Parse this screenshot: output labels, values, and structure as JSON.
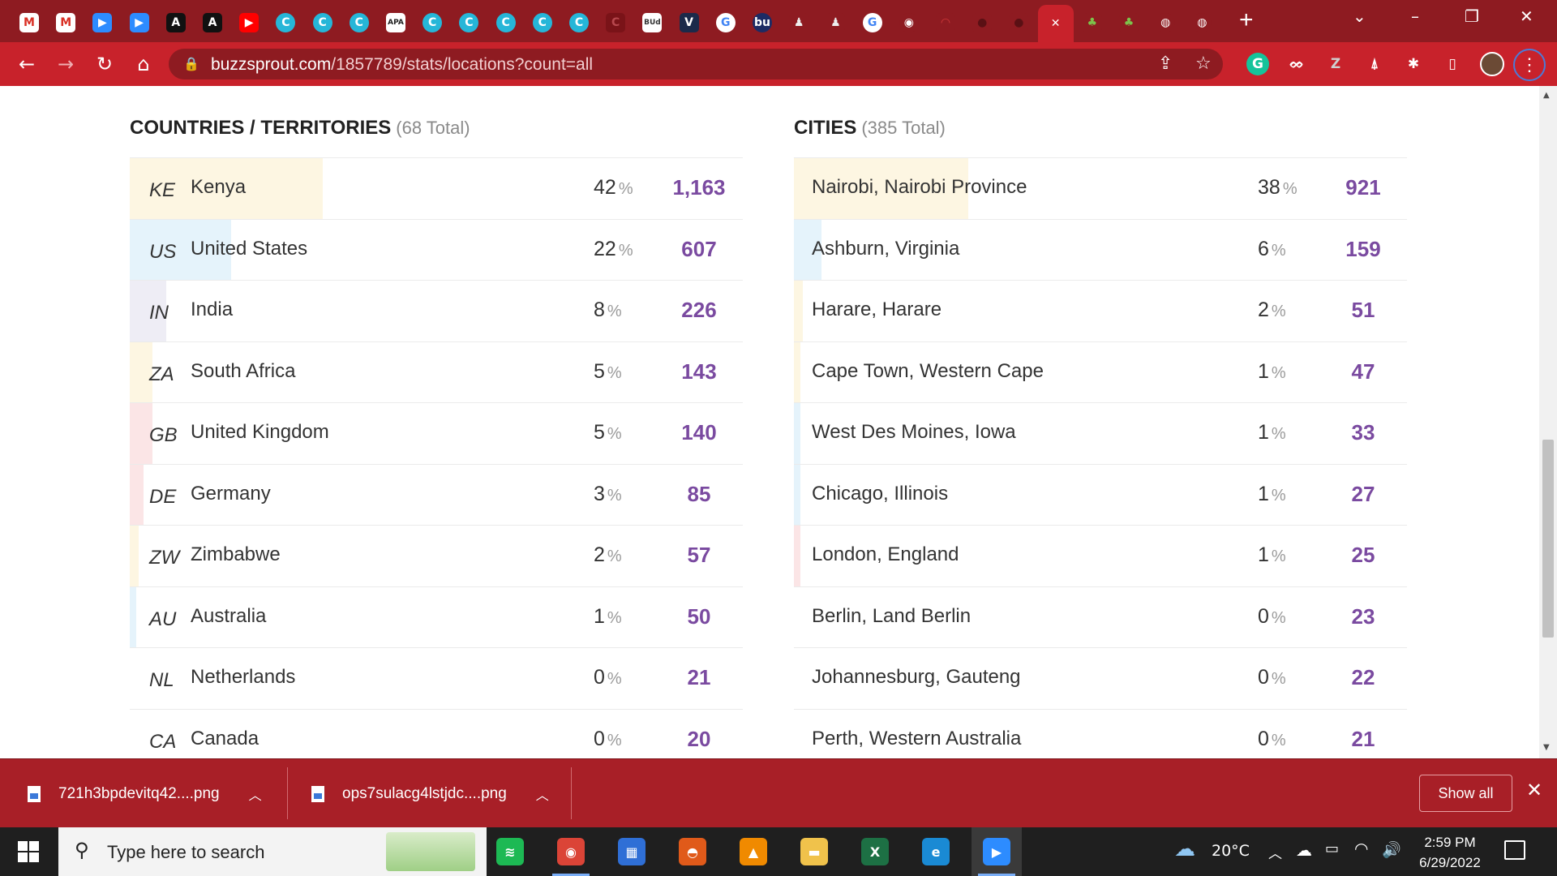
{
  "browser": {
    "tabs": [
      {
        "icon": "gmail-icon",
        "glyph": "M",
        "bg": "#ffffff",
        "fg": "#d93025"
      },
      {
        "icon": "gmail-icon",
        "glyph": "M",
        "bg": "#ffffff",
        "fg": "#d93025"
      },
      {
        "icon": "zoom-icon",
        "glyph": "▶",
        "bg": "#2d8cff",
        "fg": "#ffffff"
      },
      {
        "icon": "zoom-icon",
        "glyph": "▶",
        "bg": "#2d8cff",
        "fg": "#ffffff"
      },
      {
        "icon": "a-letter-icon",
        "glyph": "A",
        "bg": "#111111",
        "fg": "#ffffff"
      },
      {
        "icon": "a-letter-icon",
        "glyph": "A",
        "bg": "#111111",
        "fg": "#ffffff"
      },
      {
        "icon": "youtube-icon",
        "glyph": "▶",
        "bg": "#ff0000",
        "fg": "#ffffff"
      },
      {
        "icon": "canva-icon",
        "glyph": "C",
        "bg": "#26b6d8",
        "fg": "#ffffff"
      },
      {
        "icon": "canva-icon",
        "glyph": "C",
        "bg": "#26b6d8",
        "fg": "#ffffff"
      },
      {
        "icon": "canva-icon",
        "glyph": "C",
        "bg": "#26b6d8",
        "fg": "#ffffff"
      },
      {
        "icon": "apa-icon",
        "glyph": "APA",
        "bg": "#ffffff",
        "fg": "#222222"
      },
      {
        "icon": "canva-icon",
        "glyph": "C",
        "bg": "#26b6d8",
        "fg": "#ffffff"
      },
      {
        "icon": "canva-icon",
        "glyph": "C",
        "bg": "#26b6d8",
        "fg": "#ffffff"
      },
      {
        "icon": "canva-icon",
        "glyph": "C",
        "bg": "#26b6d8",
        "fg": "#ffffff"
      },
      {
        "icon": "canva-icon",
        "glyph": "C",
        "bg": "#26b6d8",
        "fg": "#ffffff"
      },
      {
        "icon": "canva-icon",
        "glyph": "C",
        "bg": "#26b6d8",
        "fg": "#ffffff"
      },
      {
        "icon": "app-icon",
        "glyph": "C",
        "bg": "#7a1318",
        "fg": "#b8484e"
      },
      {
        "icon": "bud-icon",
        "glyph": "BUd",
        "bg": "#ffffff",
        "fg": "#333333"
      },
      {
        "icon": "v-letter-icon",
        "glyph": "V",
        "bg": "#1b2a4a",
        "fg": "#ffffff"
      },
      {
        "icon": "google-icon",
        "glyph": "G",
        "bg": "#ffffff",
        "fg": "#4285f4"
      },
      {
        "icon": "bu-icon",
        "glyph": "bu",
        "bg": "#1d2b64",
        "fg": "#ffffff"
      },
      {
        "icon": "figure-icon",
        "glyph": "♟",
        "bg": "#8e1b21",
        "fg": "#eeeeee"
      },
      {
        "icon": "figure-icon",
        "glyph": "♟",
        "bg": "#8e1b21",
        "fg": "#eeeeee"
      },
      {
        "icon": "google-icon",
        "glyph": "G",
        "bg": "#ffffff",
        "fg": "#4285f4"
      },
      {
        "icon": "chrome-icon",
        "glyph": "◉",
        "bg": "#8e1b21",
        "fg": "#ffffff"
      },
      {
        "icon": "gauge-icon",
        "glyph": "◠",
        "bg": "#8e1b21",
        "fg": "#d23a3a"
      },
      {
        "icon": "github-icon",
        "glyph": "●",
        "bg": "#8e1b21",
        "fg": "#5a1014"
      },
      {
        "icon": "github-icon",
        "glyph": "●",
        "bg": "#8e1b21",
        "fg": "#5a1014"
      },
      {
        "icon": "close-tab-icon",
        "glyph": "✕",
        "bg": "#c8222b",
        "fg": "#ffffff"
      },
      {
        "icon": "plant-icon",
        "glyph": "♣",
        "bg": "#8e1b21",
        "fg": "#7dc24b"
      },
      {
        "icon": "plant-icon",
        "glyph": "♣",
        "bg": "#8e1b21",
        "fg": "#7dc24b"
      },
      {
        "icon": "globe-icon",
        "glyph": "◍",
        "bg": "#8e1b21",
        "fg": "#ffffff"
      },
      {
        "icon": "globe-icon",
        "glyph": "◍",
        "bg": "#8e1b21",
        "fg": "#ffffff"
      }
    ],
    "url_host": "buzzsprout.com",
    "url_path": "/1857789/stats/locations?count=all"
  },
  "countries": {
    "title": "COUNTRIES / TERRITORIES",
    "total": "(68 Total)",
    "rows": [
      {
        "code": "KE",
        "name": "Kenya",
        "pct": "42",
        "count": "1,163",
        "share": 0.42,
        "color": "#fdf6e2"
      },
      {
        "code": "US",
        "name": "United States",
        "pct": "22",
        "count": "607",
        "share": 0.22,
        "color": "#e5f3fb"
      },
      {
        "code": "IN",
        "name": "India",
        "pct": "8",
        "count": "226",
        "share": 0.08,
        "color": "#eeedf5"
      },
      {
        "code": "ZA",
        "name": "South Africa",
        "pct": "5",
        "count": "143",
        "share": 0.05,
        "color": "#fdf6e2"
      },
      {
        "code": "GB",
        "name": "United Kingdom",
        "pct": "5",
        "count": "140",
        "share": 0.05,
        "color": "#fbe5e6"
      },
      {
        "code": "DE",
        "name": "Germany",
        "pct": "3",
        "count": "85",
        "share": 0.03,
        "color": "#fbe5e6"
      },
      {
        "code": "ZW",
        "name": "Zimbabwe",
        "pct": "2",
        "count": "57",
        "share": 0.02,
        "color": "#fdf6e2"
      },
      {
        "code": "AU",
        "name": "Australia",
        "pct": "1",
        "count": "50",
        "share": 0.01,
        "color": "#e5f3fb"
      },
      {
        "code": "NL",
        "name": "Netherlands",
        "pct": "0",
        "count": "21",
        "share": 0,
        "color": "#ffffff"
      },
      {
        "code": "CA",
        "name": "Canada",
        "pct": "0",
        "count": "20",
        "share": 0,
        "color": "#ffffff"
      }
    ]
  },
  "cities": {
    "title": "CITIES",
    "total": "(385 Total)",
    "rows": [
      {
        "name": "Nairobi, Nairobi Province",
        "pct": "38",
        "count": "921",
        "share": 0.38,
        "color": "#fdf6e2"
      },
      {
        "name": "Ashburn, Virginia",
        "pct": "6",
        "count": "159",
        "share": 0.06,
        "color": "#e5f3fb"
      },
      {
        "name": "Harare, Harare",
        "pct": "2",
        "count": "51",
        "share": 0.02,
        "color": "#fdf6e2"
      },
      {
        "name": "Cape Town, Western Cape",
        "pct": "1",
        "count": "47",
        "share": 0.01,
        "color": "#fdf6e2"
      },
      {
        "name": "West Des Moines, Iowa",
        "pct": "1",
        "count": "33",
        "share": 0.01,
        "color": "#e5f3fb"
      },
      {
        "name": "Chicago, Illinois",
        "pct": "1",
        "count": "27",
        "share": 0.01,
        "color": "#e5f3fb"
      },
      {
        "name": "London, England",
        "pct": "1",
        "count": "25",
        "share": 0.01,
        "color": "#fbe5e6"
      },
      {
        "name": "Berlin, Land Berlin",
        "pct": "0",
        "count": "23",
        "share": 0,
        "color": "#ffffff"
      },
      {
        "name": "Johannesburg, Gauteng",
        "pct": "0",
        "count": "22",
        "share": 0,
        "color": "#ffffff"
      },
      {
        "name": "Perth, Western Australia",
        "pct": "0",
        "count": "21",
        "share": 0,
        "color": "#ffffff"
      }
    ]
  },
  "percent_sign": "%",
  "downloads": {
    "items": [
      {
        "name": "721h3bpdevitq42....png"
      },
      {
        "name": "ops7sulacg4lstjdc....png"
      }
    ],
    "show_all": "Show all"
  },
  "taskbar": {
    "search_placeholder": "Type here to search",
    "weather": "20°C",
    "time": "2:59 PM",
    "date": "6/29/2022",
    "apps": [
      {
        "icon": "spotify-icon",
        "glyph": "≋",
        "bg": "#1db954"
      },
      {
        "icon": "chrome-icon",
        "glyph": "◉",
        "bg": "#db4437"
      },
      {
        "icon": "calendar-icon",
        "glyph": "▦",
        "bg": "#2f6fd6"
      },
      {
        "icon": "app-icon",
        "glyph": "◓",
        "bg": "#e05a1a"
      },
      {
        "icon": "vlc-icon",
        "glyph": "▲",
        "bg": "#f08a00"
      },
      {
        "icon": "file-explorer-icon",
        "glyph": "▬",
        "bg": "#f0c24b"
      },
      {
        "icon": "excel-icon",
        "glyph": "X",
        "bg": "#1d7044"
      },
      {
        "icon": "edge-icon",
        "glyph": "e",
        "bg": "#1a8ad4"
      },
      {
        "icon": "zoom-icon",
        "glyph": "▶",
        "bg": "#2d8cff"
      }
    ]
  }
}
